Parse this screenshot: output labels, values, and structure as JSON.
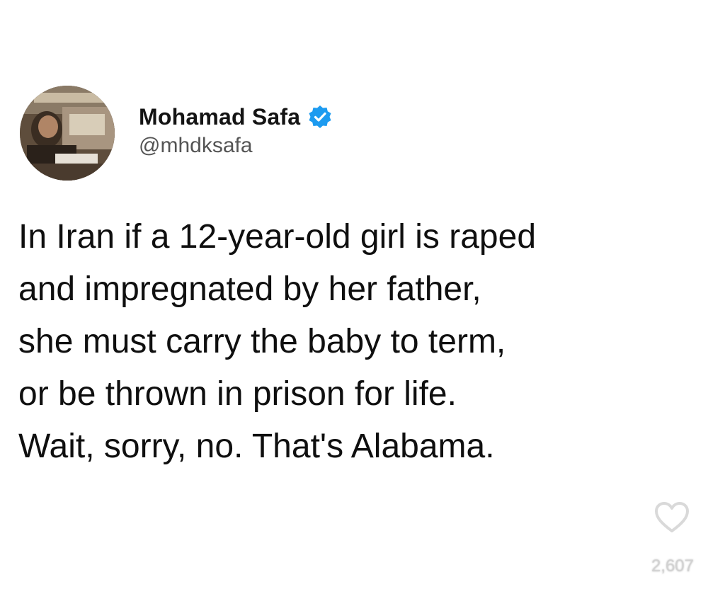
{
  "tweet": {
    "author": {
      "display_name": "Mohamad Safa",
      "handle": "@mhdksafa",
      "verified": true,
      "verified_color": "#1d9bf0"
    },
    "text_lines": [
      "In Iran if a 12-year-old girl is raped",
      "and impregnated by her father,",
      "she must carry the baby to term,",
      "or be thrown in prison for life.",
      "Wait, sorry, no. That's Alabama."
    ]
  },
  "overlay": {
    "like_icon": "heart-outline-icon",
    "like_count": "2,607"
  }
}
